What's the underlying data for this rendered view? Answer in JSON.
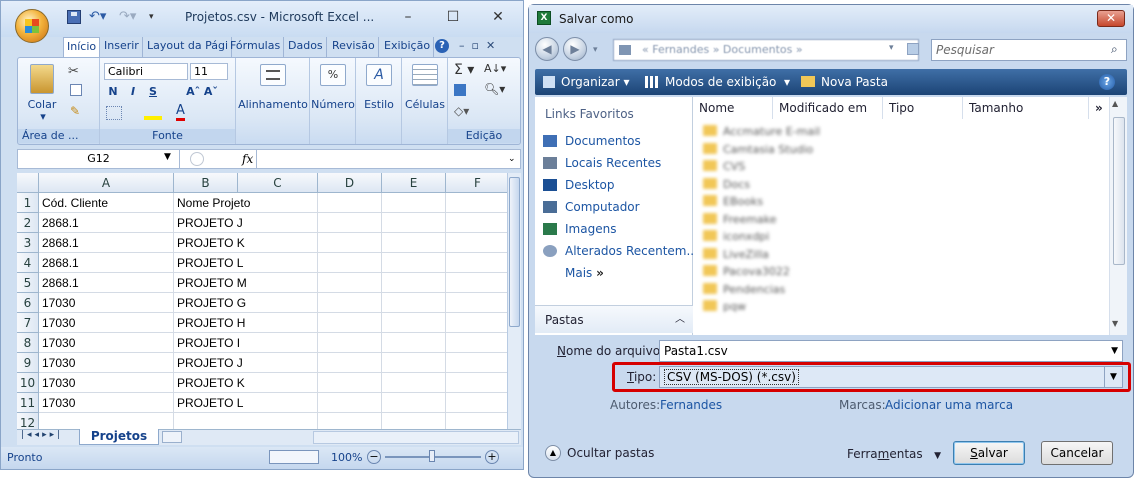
{
  "excel": {
    "title": "Projetos.csv - Microsoft Excel ...",
    "tabs": [
      "Início",
      "Inserir",
      "Layout da Pági",
      "Fórmulas",
      "Dados",
      "Revisão",
      "Exibição"
    ],
    "groups": {
      "clipboard": "Área de ...",
      "paste": "Colar",
      "font": "Fonte",
      "font_name": "Calibri",
      "font_size": "11",
      "bold": "N",
      "italic": "I",
      "underline": "S",
      "alignment": "Alinhamento",
      "number": "Número",
      "style": "Estilo",
      "cells": "Células",
      "edit": "Edição"
    },
    "name_box": "G12",
    "fx": "fx",
    "columns": [
      "A",
      "B",
      "C",
      "D",
      "E",
      "F"
    ],
    "rows": [
      [
        "1",
        "Cód. Cliente",
        "Nome Projeto"
      ],
      [
        "2",
        "2868.1",
        "PROJETO J"
      ],
      [
        "3",
        "2868.1",
        "PROJETO K"
      ],
      [
        "4",
        "2868.1",
        "PROJETO L"
      ],
      [
        "5",
        "2868.1",
        "PROJETO M"
      ],
      [
        "6",
        "17030",
        "PROJETO G"
      ],
      [
        "7",
        "17030",
        "PROJETO H"
      ],
      [
        "8",
        "17030",
        "PROJETO I"
      ],
      [
        "9",
        "17030",
        "PROJETO J"
      ],
      [
        "10",
        "17030",
        "PROJETO K"
      ],
      [
        "11",
        "17030",
        "PROJETO L"
      ],
      [
        "12",
        "",
        ""
      ]
    ],
    "sheet_tab": "Projetos",
    "status": "Pronto",
    "zoom": "100%"
  },
  "dialog": {
    "title": "Salvar como",
    "path": "« Fernandes » Documentos »",
    "search_placeholder": "Pesquisar",
    "toolbar": {
      "organize": "Organizar",
      "views": "Modos de exibição",
      "new_folder": "Nova Pasta"
    },
    "favorites_title": "Links Favoritos",
    "favorites": [
      "Documentos",
      "Locais Recentes",
      "Desktop",
      "Computador",
      "Imagens",
      "Alterados Recentem...",
      "Mais"
    ],
    "folders_label": "Pastas",
    "columns": [
      "Nome",
      "Modificado em",
      "Tipo",
      "Tamanho"
    ],
    "files": [
      "Accmature E-mail",
      "Camtasia Studio",
      "CVS",
      "Docs",
      "EBooks",
      "Freemake",
      "iconxdpi",
      "LiveZilla",
      "Pacova3022",
      "Pendencias",
      "pqw"
    ],
    "filename_label": "Nome do arquivo:",
    "filename": "Pasta1.csv",
    "type_label": "Tipo:",
    "type_value": "CSV (MS-DOS) (*.csv)",
    "authors_label": "Autores:",
    "authors_value": "Fernandes",
    "tags_label": "Marcas:",
    "tags_value": "Adicionar uma marca",
    "hide_folders": "Ocultar pastas",
    "tools": "Ferramentas",
    "save": "Salvar",
    "cancel": "Cancelar"
  }
}
